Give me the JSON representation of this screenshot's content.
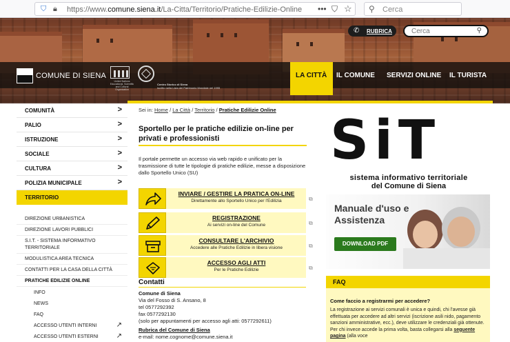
{
  "browser": {
    "url_prefix": "https://www.",
    "url_domain": "comune.siena.it",
    "url_path": "/La-Citta/Territorio/Pratiche-Edilizie-Online",
    "search_placeholder": "Cerca"
  },
  "header": {
    "rubrica_label": "RUBRICA",
    "search_placeholder": "Cerca",
    "logo_text": "COMUNE DI SIENA",
    "unesco_text": "United Nations Educational, Scientific and Cultural Organization",
    "heritage_title": "Centro Storico di Siena",
    "heritage_sub": "iscritto nella Lista del Patrimonio Mondiale nel 1995",
    "nav": [
      {
        "label": "LA CITTÀ"
      },
      {
        "label": "IL COMUNE"
      },
      {
        "label": "SERVIZI ONLINE"
      },
      {
        "label": "IL TURISTA"
      }
    ]
  },
  "sidebar": {
    "items": [
      {
        "label": "COMUNITÀ"
      },
      {
        "label": "PALIO"
      },
      {
        "label": "ISTRUZIONE"
      },
      {
        "label": "SOCIALE"
      },
      {
        "label": "CULTURA"
      },
      {
        "label": "POLIZIA MUNICIPALE"
      },
      {
        "label": "TERRITORIO"
      }
    ],
    "subitems": [
      {
        "label": "DIREZIONE URBANISTICA"
      },
      {
        "label": "DIREZIONE LAVORI PUBBLICI"
      },
      {
        "label": "S.I.T. - SISTEMA INFORMATIVO TERRITORIALE"
      },
      {
        "label": "MODULISTICA AREA TECNICA"
      },
      {
        "label": "CONTATTI PER LA CASA DELLA CITTÀ"
      },
      {
        "label": "PRATICHE EDILIZIE ONLINE"
      }
    ],
    "subsub": [
      {
        "label": "INFO"
      },
      {
        "label": "NEWS"
      },
      {
        "label": "FAQ"
      },
      {
        "label": "ACCESSO UTENTI INTERNI"
      },
      {
        "label": "ACCESSO UTENTI ESTERNI"
      }
    ]
  },
  "breadcrumb": {
    "prefix": "Sei in:",
    "home": "Home",
    "sep": "/",
    "city": "La Città",
    "territory": "Territorio",
    "current": "Pratiche Edilizie Online"
  },
  "main": {
    "title": "Sportello per le pratiche edilizie on-line per privati e professionisti",
    "intro": "Il portale permette un accesso via web rapido e unificato per la trasmissione di tutte le tipologie di pratiche edilizie, messe a disposizione dallo Sportello Unico (SU)",
    "actions": [
      {
        "title": "INVIARE / GESTIRE LA PRATICA ON-LINE",
        "sub": "Direttamente allo Sportello Unico per l'Edilizia"
      },
      {
        "title": "REGISTRAZIONE",
        "sub": "Ai servizi on-line del Comune"
      },
      {
        "title": "CONSULTARE L'ARCHIVIO",
        "sub": "Accedere alle Pratiche Edilizie in libera visione"
      },
      {
        "title": "ACCESSO AGLI ATTI",
        "sub": "Per le Pratiche Edilizie"
      }
    ]
  },
  "contacts": {
    "heading": "Contatti",
    "org": "Comune di Siena",
    "address": "Via del Fosso di S. Ansano, 8",
    "tel": "tel   0577292392",
    "fax": "fax  0577292130",
    "note": "(solo per appuntamenti per accesso agli atti: 0577292611)",
    "rubrica": "Rubrica del Comune di Siena",
    "email": "e-mail: nome.cognome@comune.siena.it"
  },
  "sit": {
    "logo": "SiT",
    "line1": "sistema  informativo territoriale",
    "line2": "del Comune di Siena"
  },
  "manual": {
    "title": "Manuale d'uso e Assistenza",
    "button": "DOWNLOAD PDF"
  },
  "faq": {
    "heading": "FAQ",
    "question": "Come faccio a registrarmi per accedere?",
    "answer_pre": "La registrazione ai servizi comunali è unica e quindi, chi l'avesse già effettuata per accedere ad altri servizi (iscrizione asili nido, pagamento sanzioni amministrative, ecc.), deve utilizzare le credenziali già ottenute. Per chi invece accede la prima volta, basta collegarsi alla ",
    "answer_link": "seguente pagina",
    "answer_post": " (alla voce"
  },
  "colors": {
    "accent_yellow": "#f3d500",
    "light_yellow": "#fff9c0",
    "download_green": "#2b7a1d"
  }
}
